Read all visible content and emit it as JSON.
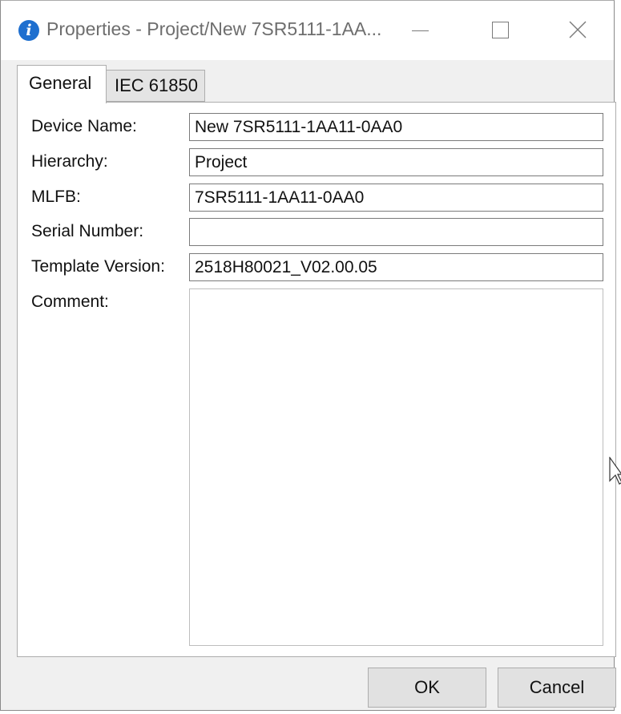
{
  "window": {
    "title": "Properties - Project/New 7SR5111-1AA...",
    "icon": "info-icon",
    "controls": {
      "minimize_icon": "minimize-icon",
      "maximize_icon": "maximize-icon",
      "close_icon": "close-icon"
    }
  },
  "tabs": [
    {
      "label": "General",
      "active": true
    },
    {
      "label": "IEC 61850",
      "active": false
    }
  ],
  "fields": {
    "device_name": {
      "label": "Device Name:",
      "value": "New 7SR5111-1AA11-0AA0"
    },
    "hierarchy": {
      "label": "Hierarchy:",
      "value": "Project"
    },
    "mlfb": {
      "label": "MLFB:",
      "value": "7SR5111-1AA11-0AA0"
    },
    "serial_number": {
      "label": "Serial Number:",
      "value": ""
    },
    "template_version": {
      "label": "Template Version:",
      "value": "2518H80021_V02.00.05"
    },
    "comment": {
      "label": "Comment:",
      "value": ""
    }
  },
  "buttons": {
    "ok": "OK",
    "cancel": "Cancel"
  },
  "colors": {
    "title_icon": "#1e6fcf",
    "dialog_background": "#f0f0f0",
    "button_background": "#e1e1e1"
  }
}
